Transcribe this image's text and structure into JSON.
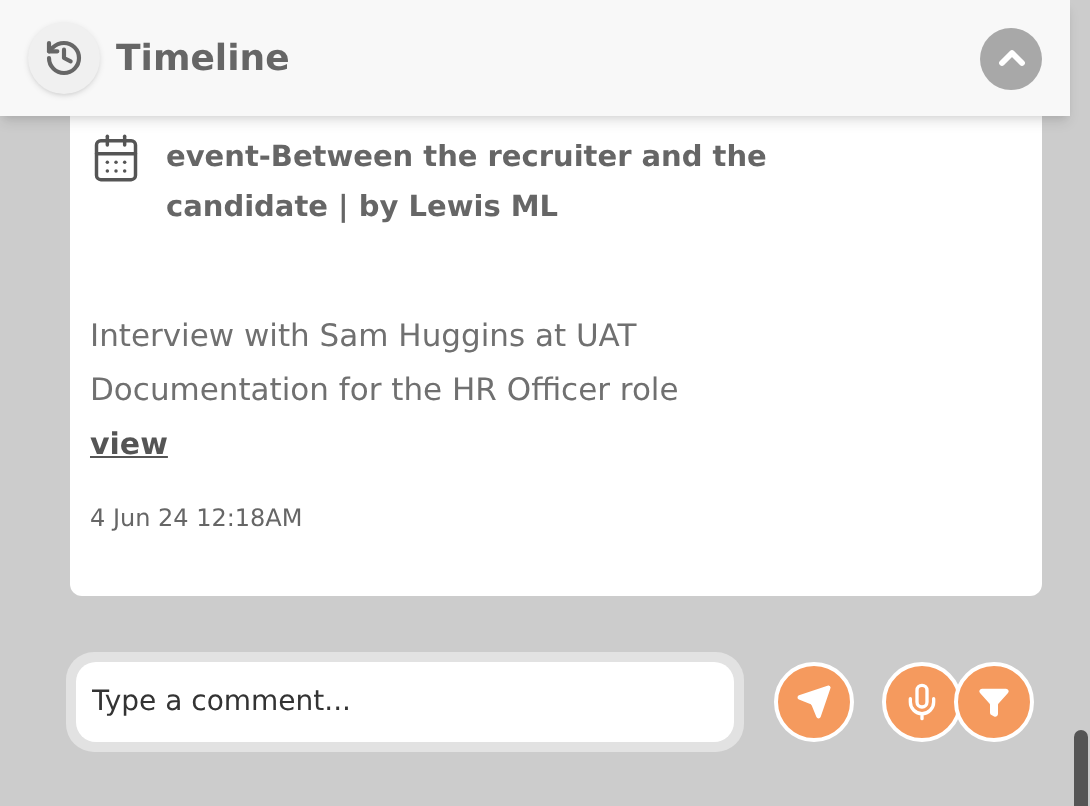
{
  "header": {
    "title": "Timeline"
  },
  "event": {
    "title": "event-Between the recruiter and the candidate | by Lewis ML",
    "description": "Interview with Sam Huggins at UAT Documentation for the HR Officer role",
    "link": "view",
    "timestamp": "4 Jun 24 12:18AM"
  },
  "comment": {
    "placeholder": "Type a comment..."
  }
}
